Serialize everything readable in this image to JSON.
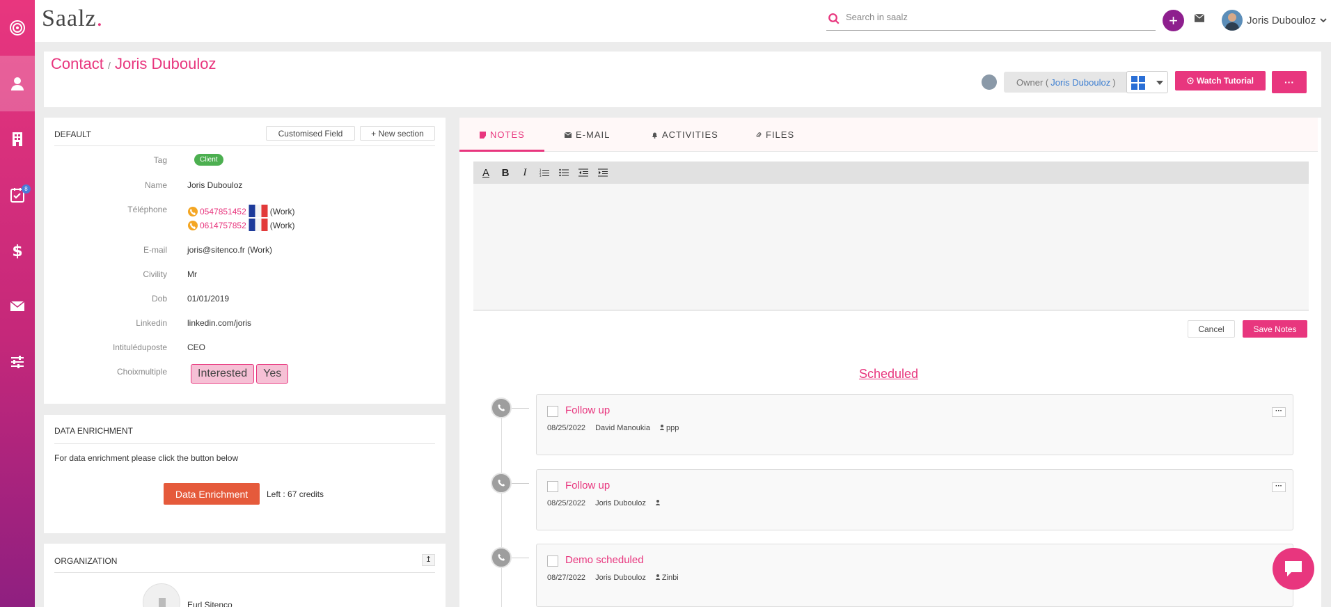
{
  "sidebar": {
    "tasks_badge": "8"
  },
  "topbar": {
    "logo_prefix": "S",
    "logo_mid": "aalz",
    "logo_dot": ".",
    "search_placeholder": "Search in saalz",
    "plus_label": "+",
    "user_name": "Joris Dubouloz"
  },
  "header": {
    "crumb_root": "Contact",
    "crumb_sep": "/",
    "crumb_name": "Joris Dubouloz",
    "owner_prefix": "Owner (",
    "owner_name": "Joris Dubouloz",
    "owner_suffix": ")",
    "watch_label": "Watch Tutorial",
    "more_label": "···"
  },
  "default_card": {
    "title": "DEFAULT",
    "customised_field_label": "Customised Field",
    "new_section_label": "+ New section",
    "fields": {
      "tag_label": "Tag",
      "tag_value": "Client",
      "name_label": "Name",
      "name_value": "Joris Dubouloz",
      "telephone_label": "Téléphone",
      "phone1": "0547851452",
      "phone1_type": "(Work)",
      "phone2": "0614757852",
      "phone2_type": "(Work)",
      "email_label": "E-mail",
      "email_value": "joris@sitenco.fr (Work)",
      "civility_label": "Civility",
      "civility_value": "Mr",
      "dob_label": "Dob",
      "dob_value": "01/01/2019",
      "linkedin_label": "Linkedin",
      "linkedin_value": "linkedin.com/joris",
      "poste_label": "Intituléduposte",
      "poste_value": "CEO",
      "choix_label": "Choixmultiple",
      "choix_1": "Interested",
      "choix_2": "Yes"
    }
  },
  "enrichment_card": {
    "title": "DATA ENRICHMENT",
    "text": "For data enrichment please click the button below",
    "button_label": "Data Enrichment",
    "credits": "Left : 67 credits"
  },
  "organization_card": {
    "title": "ORGANIZATION",
    "company": "Eurl Sitenco"
  },
  "tabs": [
    {
      "label": "NOTES",
      "icon": "note-icon"
    },
    {
      "label": "E-MAIL",
      "icon": "envelope-icon"
    },
    {
      "label": "ACTIVITIES",
      "icon": "bell-icon"
    },
    {
      "label": "FILES",
      "icon": "paperclip-icon"
    }
  ],
  "editor": {
    "cancel_label": "Cancel",
    "save_label": "Save Notes"
  },
  "scheduled_heading": "Scheduled",
  "timeline": [
    {
      "title": "Follow up",
      "date": "08/25/2022",
      "person": "David Manoukia",
      "contact": "ppp"
    },
    {
      "title": "Follow up",
      "date": "08/25/2022",
      "person": "Joris Dubouloz",
      "contact": ""
    },
    {
      "title": "Demo scheduled",
      "date": "08/27/2022",
      "person": "Joris Dubouloz",
      "contact": "Zinbi"
    }
  ],
  "colors": {
    "accent": "#e8367e",
    "tag": "#4caf50",
    "enrich": "#e55a3b",
    "plus": "#8e1f8e"
  }
}
